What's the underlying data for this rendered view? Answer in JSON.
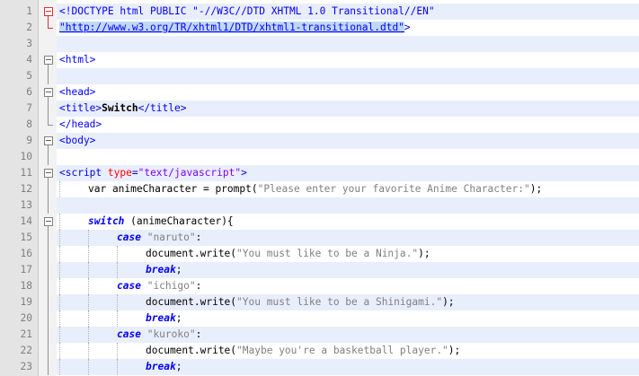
{
  "editor": {
    "colors": {
      "gutter": "#e4e4e4",
      "line_highlight": "#e9eefc",
      "tag": "#0000ff",
      "attr": "#ff0000",
      "attr_value": "#8000ff",
      "js_string": "#808080",
      "fold_marker_active": "#e03030"
    },
    "lines": [
      {
        "n": "1",
        "fold": "open-red",
        "segs": [
          [
            "tag",
            "<!DOCTYPE html PUBLIC \"-//W3C//DTD XHTML 1.0 Transitional//EN\""
          ]
        ]
      },
      {
        "n": "2",
        "fold": "end-red",
        "segs": [
          [
            "link",
            "\"http://www.w3.org/TR/xhtml1/DTD/xhtml1-transitional.dtd\""
          ],
          [
            "tag",
            ">"
          ]
        ]
      },
      {
        "n": "3",
        "fold": "none",
        "segs": []
      },
      {
        "n": "4",
        "fold": "open",
        "segs": [
          [
            "tag",
            "<html>"
          ]
        ]
      },
      {
        "n": "5",
        "fold": "line",
        "segs": []
      },
      {
        "n": "6",
        "fold": "open",
        "segs": [
          [
            "tag",
            "<head>"
          ]
        ]
      },
      {
        "n": "7",
        "fold": "line",
        "segs": [
          [
            "tag",
            "<title>"
          ],
          [
            "bold",
            "Switch"
          ],
          [
            "tag",
            "</title>"
          ]
        ]
      },
      {
        "n": "8",
        "fold": "end",
        "segs": [
          [
            "tag",
            "</head>"
          ]
        ]
      },
      {
        "n": "9",
        "fold": "open",
        "segs": [
          [
            "tag",
            "<body>"
          ]
        ]
      },
      {
        "n": "10",
        "fold": "line",
        "segs": []
      },
      {
        "n": "11",
        "fold": "open",
        "segs": [
          [
            "tag",
            "<script "
          ],
          [
            "attr",
            "type"
          ],
          [
            "tag",
            "="
          ],
          [
            "str",
            "\"text/javascript\""
          ],
          [
            "tag",
            ">"
          ]
        ]
      },
      {
        "n": "12",
        "fold": "line",
        "indent": 1,
        "segs": [
          [
            "plain",
            "var animeCharacter = prompt("
          ],
          [
            "jsstr",
            "\"Please enter your favorite Anime Character:\""
          ],
          [
            "plain",
            ");"
          ]
        ]
      },
      {
        "n": "13",
        "fold": "line",
        "segs": []
      },
      {
        "n": "14",
        "fold": "open",
        "indent": 1,
        "segs": [
          [
            "kw-switch",
            "switch"
          ],
          [
            "plain",
            " (animeCharacter){"
          ]
        ]
      },
      {
        "n": "15",
        "fold": "line",
        "indent": 2,
        "segs": [
          [
            "kw",
            "case"
          ],
          [
            "plain",
            " "
          ],
          [
            "jsstr",
            "\"naruto\""
          ],
          [
            "plain",
            ":"
          ]
        ]
      },
      {
        "n": "16",
        "fold": "line",
        "indent": 3,
        "segs": [
          [
            "plain",
            "document.write("
          ],
          [
            "jsstr",
            "\"You must like to be a Ninja.\""
          ],
          [
            "plain",
            ");"
          ]
        ]
      },
      {
        "n": "17",
        "fold": "line",
        "indent": 3,
        "segs": [
          [
            "kw",
            "break"
          ],
          [
            "plain",
            ";"
          ]
        ]
      },
      {
        "n": "18",
        "fold": "line",
        "indent": 2,
        "segs": [
          [
            "kw",
            "case"
          ],
          [
            "plain",
            " "
          ],
          [
            "jsstr",
            "\"ichigo\""
          ],
          [
            "plain",
            ":"
          ]
        ]
      },
      {
        "n": "19",
        "fold": "line",
        "indent": 3,
        "segs": [
          [
            "plain",
            "document.write("
          ],
          [
            "jsstr",
            "\"You must like to be a Shinigami.\""
          ],
          [
            "plain",
            ");"
          ]
        ]
      },
      {
        "n": "20",
        "fold": "line",
        "indent": 3,
        "segs": [
          [
            "kw",
            "break"
          ],
          [
            "plain",
            ";"
          ]
        ]
      },
      {
        "n": "21",
        "fold": "line",
        "indent": 2,
        "segs": [
          [
            "kw",
            "case"
          ],
          [
            "plain",
            " "
          ],
          [
            "jsstr",
            "\"kuroko\""
          ],
          [
            "plain",
            ":"
          ]
        ]
      },
      {
        "n": "22",
        "fold": "line",
        "indent": 3,
        "segs": [
          [
            "plain",
            "document.write("
          ],
          [
            "jsstr",
            "\"Maybe you're a basketball player.\""
          ],
          [
            "plain",
            ");"
          ]
        ]
      },
      {
        "n": "23",
        "fold": "line",
        "indent": 3,
        "segs": [
          [
            "kw",
            "break"
          ],
          [
            "plain",
            ";"
          ]
        ]
      }
    ]
  }
}
